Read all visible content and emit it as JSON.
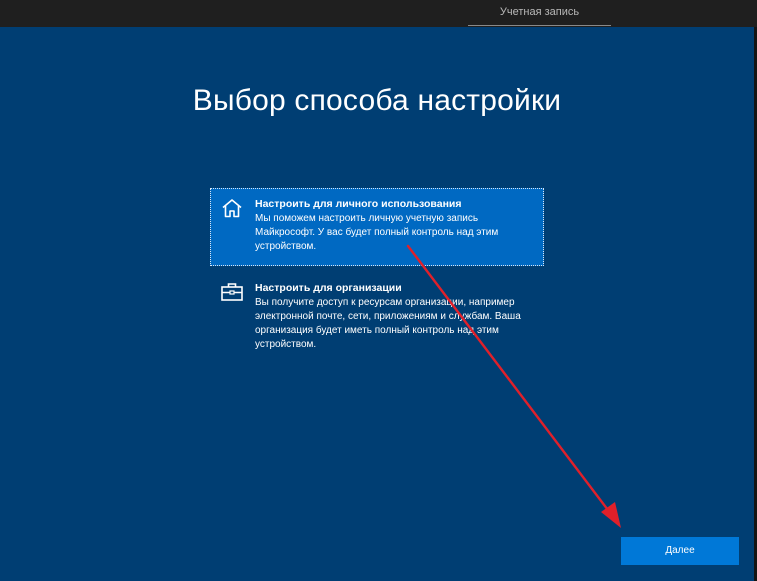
{
  "header": {
    "tab_label": "Учетная запись"
  },
  "page": {
    "title": "Выбор способа настройки"
  },
  "options": [
    {
      "title": "Настроить для личного использования",
      "description": "Мы поможем настроить личную учетную запись Майкрософт. У вас будет полный контроль над этим устройством.",
      "icon": "home-icon",
      "selected": true
    },
    {
      "title": "Настроить для организации",
      "description": "Вы получите доступ к ресурсам организации, например электронной почте, сети, приложениям и службам. Ваша организация будет иметь полный контроль над этим устройством.",
      "icon": "briefcase-icon",
      "selected": false
    }
  ],
  "footer": {
    "next_label": "Далее"
  },
  "colors": {
    "background": "#003e73",
    "selected_option": "#0069c2",
    "button": "#0078d7",
    "annotation_arrow": "#e0202a"
  }
}
